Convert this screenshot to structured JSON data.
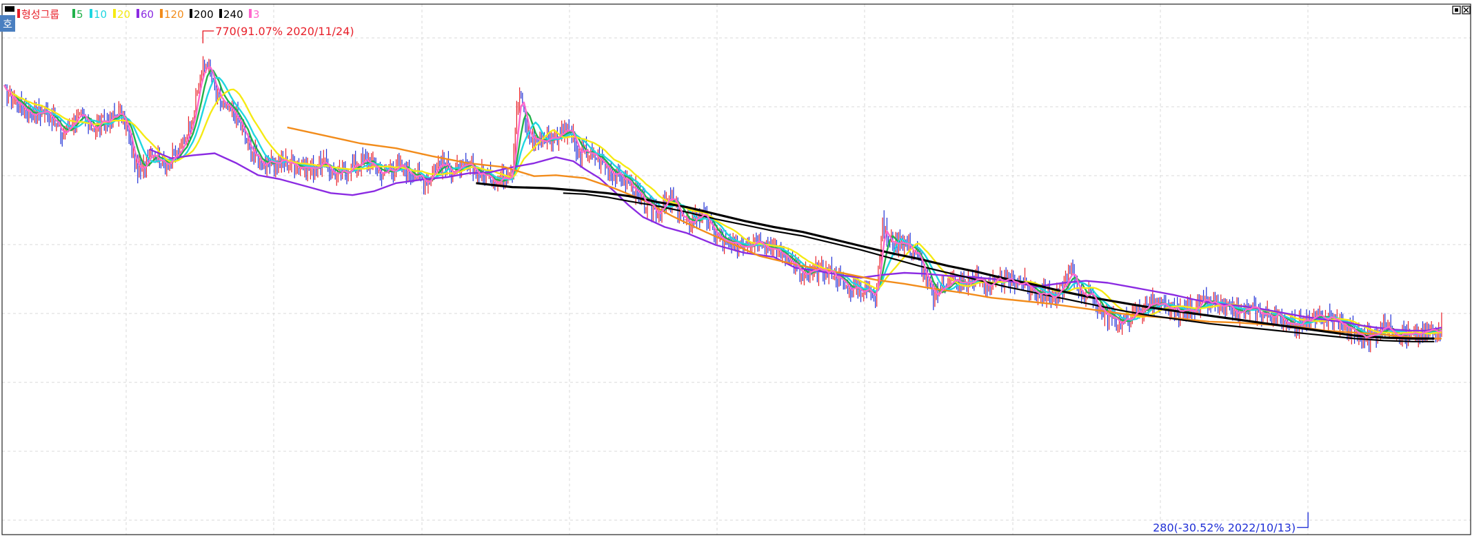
{
  "chart_data": {
    "type": "candlestick-line",
    "grid": true,
    "legend_position": "top-left",
    "legend": [
      {
        "label": "형성그룹",
        "color": "#e8202a"
      },
      {
        "label": "5",
        "color": "#21b24b"
      },
      {
        "label": "10",
        "color": "#1fd6e0"
      },
      {
        "label": "20",
        "color": "#f5ea14"
      },
      {
        "label": "60",
        "color": "#8b2be2"
      },
      {
        "label": "120",
        "color": "#f28c1b"
      },
      {
        "label": "200",
        "color": "#000000"
      },
      {
        "label": "240",
        "color": "#000000"
      },
      {
        "label": "3",
        "color": "#ff66cc"
      }
    ],
    "colors": {
      "up": "#e8202a",
      "down": "#1f2fd6",
      "grid": "#d8d8d8"
    },
    "high_marker": {
      "text": "770(91.07% 2020/11/24)",
      "value": 770,
      "color": "#e8202a"
    },
    "low_marker": {
      "text": "280(-30.52% 2022/10/13)",
      "value": 280,
      "color": "#1f2fd6"
    },
    "ylim": [
      270,
      790
    ],
    "price_path": [
      [
        0,
        713
      ],
      [
        10,
        700
      ],
      [
        20,
        690
      ],
      [
        30,
        693
      ],
      [
        40,
        668
      ],
      [
        50,
        688
      ],
      [
        60,
        676
      ],
      [
        70,
        682
      ],
      [
        80,
        691
      ],
      [
        85,
        672
      ],
      [
        90,
        640
      ],
      [
        95,
        630
      ],
      [
        100,
        655
      ],
      [
        110,
        640
      ],
      [
        120,
        648
      ],
      [
        130,
        688
      ],
      [
        135,
        728
      ],
      [
        140,
        742
      ],
      [
        145,
        712
      ],
      [
        150,
        700
      ],
      [
        160,
        686
      ],
      [
        170,
        652
      ],
      [
        180,
        638
      ],
      [
        190,
        643
      ],
      [
        200,
        640
      ],
      [
        210,
        635
      ],
      [
        220,
        640
      ],
      [
        230,
        627
      ],
      [
        240,
        638
      ],
      [
        250,
        643
      ],
      [
        260,
        630
      ],
      [
        270,
        637
      ],
      [
        280,
        632
      ],
      [
        290,
        622
      ],
      [
        300,
        640
      ],
      [
        310,
        632
      ],
      [
        320,
        636
      ],
      [
        330,
        628
      ],
      [
        340,
        623
      ],
      [
        350,
        634
      ],
      [
        353,
        700
      ],
      [
        356,
        708
      ],
      [
        360,
        668
      ],
      [
        370,
        663
      ],
      [
        380,
        668
      ],
      [
        390,
        673
      ],
      [
        395,
        648
      ],
      [
        400,
        652
      ],
      [
        410,
        644
      ],
      [
        420,
        630
      ],
      [
        430,
        622
      ],
      [
        440,
        600
      ],
      [
        450,
        592
      ],
      [
        460,
        604
      ],
      [
        470,
        578
      ],
      [
        480,
        590
      ],
      [
        490,
        568
      ],
      [
        500,
        556
      ],
      [
        510,
        560
      ],
      [
        520,
        565
      ],
      [
        530,
        553
      ],
      [
        540,
        547
      ],
      [
        550,
        526
      ],
      [
        560,
        532
      ],
      [
        570,
        532
      ],
      [
        580,
        516
      ],
      [
        590,
        514
      ],
      [
        600,
        510
      ],
      [
        605,
        578
      ],
      [
        610,
        560
      ],
      [
        620,
        562
      ],
      [
        630,
        545
      ],
      [
        640,
        504
      ],
      [
        650,
        522
      ],
      [
        660,
        519
      ],
      [
        670,
        523
      ],
      [
        680,
        518
      ],
      [
        690,
        522
      ],
      [
        700,
        521
      ],
      [
        710,
        512
      ],
      [
        725,
        506
      ],
      [
        735,
        531
      ],
      [
        740,
        514
      ],
      [
        750,
        504
      ],
      [
        760,
        486
      ],
      [
        770,
        480
      ],
      [
        780,
        490
      ],
      [
        790,
        500
      ],
      [
        800,
        494
      ],
      [
        810,
        490
      ],
      [
        820,
        496
      ],
      [
        830,
        500
      ],
      [
        840,
        494
      ],
      [
        850,
        490
      ],
      [
        860,
        494
      ],
      [
        870,
        488
      ],
      [
        880,
        485
      ],
      [
        890,
        478
      ],
      [
        900,
        482
      ],
      [
        910,
        486
      ],
      [
        920,
        480
      ],
      [
        930,
        470
      ],
      [
        940,
        465
      ],
      [
        950,
        476
      ],
      [
        960,
        472
      ],
      [
        970,
        466
      ],
      [
        980,
        470
      ],
      [
        990,
        478
      ]
    ],
    "series": [
      {
        "name": "5",
        "color": "#21b24b",
        "lag": 4
      },
      {
        "name": "10",
        "color": "#1fd6e0",
        "lag": 7
      },
      {
        "name": "20",
        "color": "#f5ea14",
        "lag": 13
      },
      {
        "name": "60",
        "color": "#8b2be2",
        "points": [
          [
            100,
            654
          ],
          [
            115,
            645
          ],
          [
            130,
            648
          ],
          [
            145,
            650
          ],
          [
            160,
            640
          ],
          [
            175,
            628
          ],
          [
            190,
            624
          ],
          [
            210,
            616
          ],
          [
            225,
            610
          ],
          [
            240,
            608
          ],
          [
            255,
            612
          ],
          [
            270,
            620
          ],
          [
            290,
            624
          ],
          [
            305,
            626
          ],
          [
            320,
            630
          ],
          [
            335,
            631
          ],
          [
            350,
            636
          ],
          [
            365,
            640
          ],
          [
            380,
            646
          ],
          [
            392,
            642
          ],
          [
            400,
            634
          ],
          [
            410,
            625
          ],
          [
            420,
            612
          ],
          [
            430,
            598
          ],
          [
            440,
            586
          ],
          [
            455,
            576
          ],
          [
            470,
            570
          ],
          [
            490,
            558
          ],
          [
            510,
            550
          ],
          [
            530,
            546
          ],
          [
            545,
            535
          ],
          [
            560,
            532
          ],
          [
            575,
            528
          ],
          [
            590,
            525
          ],
          [
            605,
            528
          ],
          [
            620,
            530
          ],
          [
            635,
            529
          ],
          [
            650,
            527
          ],
          [
            665,
            526
          ],
          [
            680,
            524
          ],
          [
            695,
            521
          ],
          [
            710,
            516
          ],
          [
            730,
            520
          ],
          [
            745,
            522
          ],
          [
            760,
            520
          ],
          [
            775,
            516
          ],
          [
            790,
            512
          ],
          [
            805,
            508
          ],
          [
            820,
            503
          ],
          [
            835,
            499
          ],
          [
            850,
            497
          ],
          [
            865,
            494
          ],
          [
            880,
            490
          ],
          [
            895,
            486
          ],
          [
            905,
            484
          ],
          [
            915,
            482
          ],
          [
            925,
            480
          ],
          [
            935,
            477
          ],
          [
            945,
            475
          ],
          [
            958,
            473
          ],
          [
            968,
            472
          ],
          [
            980,
            472
          ],
          [
            990,
            475
          ]
        ]
      },
      {
        "name": "120",
        "color": "#f28c1b",
        "points": [
          [
            195,
            676
          ],
          [
            220,
            668
          ],
          [
            245,
            660
          ],
          [
            270,
            655
          ],
          [
            295,
            647
          ],
          [
            320,
            640
          ],
          [
            345,
            636
          ],
          [
            365,
            627
          ],
          [
            380,
            628
          ],
          [
            400,
            625
          ],
          [
            420,
            615
          ],
          [
            440,
            603
          ],
          [
            460,
            587
          ],
          [
            480,
            573
          ],
          [
            500,
            560
          ],
          [
            520,
            547
          ],
          [
            540,
            540
          ],
          [
            560,
            534
          ],
          [
            580,
            529
          ],
          [
            600,
            523
          ],
          [
            620,
            519
          ],
          [
            640,
            514
          ],
          [
            660,
            510
          ],
          [
            680,
            505
          ],
          [
            700,
            502
          ],
          [
            720,
            499
          ],
          [
            745,
            494
          ],
          [
            770,
            489
          ],
          [
            790,
            486
          ],
          [
            810,
            484
          ],
          [
            830,
            481
          ],
          [
            850,
            480
          ],
          [
            870,
            478
          ],
          [
            890,
            476
          ],
          [
            910,
            472
          ],
          [
            930,
            470
          ],
          [
            950,
            468
          ],
          [
            970,
            465
          ],
          [
            985,
            464
          ],
          [
            990,
            464
          ]
        ]
      },
      {
        "name": "200",
        "color": "#000000",
        "points": [
          [
            325,
            620
          ],
          [
            350,
            616
          ],
          [
            375,
            615
          ],
          [
            400,
            612
          ],
          [
            415,
            610
          ],
          [
            430,
            607
          ],
          [
            450,
            601
          ],
          [
            470,
            596
          ],
          [
            490,
            589
          ],
          [
            510,
            582
          ],
          [
            530,
            576
          ],
          [
            550,
            571
          ],
          [
            570,
            564
          ],
          [
            590,
            557
          ],
          [
            610,
            550
          ],
          [
            630,
            544
          ],
          [
            650,
            537
          ],
          [
            670,
            531
          ],
          [
            690,
            524
          ],
          [
            710,
            518
          ],
          [
            730,
            511
          ],
          [
            750,
            505
          ],
          [
            770,
            500
          ],
          [
            790,
            495
          ],
          [
            810,
            491
          ],
          [
            830,
            487
          ],
          [
            850,
            483
          ],
          [
            870,
            479
          ],
          [
            890,
            475
          ],
          [
            910,
            471
          ],
          [
            930,
            467
          ],
          [
            950,
            465
          ],
          [
            970,
            464
          ],
          [
            985,
            464
          ]
        ]
      },
      {
        "name": "240",
        "color": "#000000",
        "points": [
          [
            385,
            610
          ],
          [
            400,
            609
          ],
          [
            415,
            606
          ],
          [
            430,
            602
          ],
          [
            450,
            597
          ],
          [
            470,
            591
          ],
          [
            490,
            584
          ],
          [
            510,
            578
          ],
          [
            530,
            572
          ],
          [
            550,
            567
          ],
          [
            570,
            560
          ],
          [
            590,
            553
          ],
          [
            610,
            545
          ],
          [
            630,
            537
          ],
          [
            650,
            530
          ],
          [
            670,
            523
          ],
          [
            690,
            516
          ],
          [
            710,
            510
          ],
          [
            730,
            504
          ],
          [
            750,
            498
          ],
          [
            770,
            492
          ],
          [
            790,
            487
          ],
          [
            810,
            483
          ],
          [
            830,
            479
          ],
          [
            850,
            476
          ],
          [
            870,
            473
          ],
          [
            890,
            470
          ],
          [
            910,
            467
          ],
          [
            930,
            464
          ],
          [
            950,
            462
          ],
          [
            970,
            461
          ],
          [
            985,
            461
          ]
        ]
      },
      {
        "name": "3",
        "color": "#ff66cc",
        "lag": 2
      }
    ]
  },
  "toolbar": {
    "left_icon_label": "호",
    "left_icon_bg": "#4a7fc0"
  }
}
